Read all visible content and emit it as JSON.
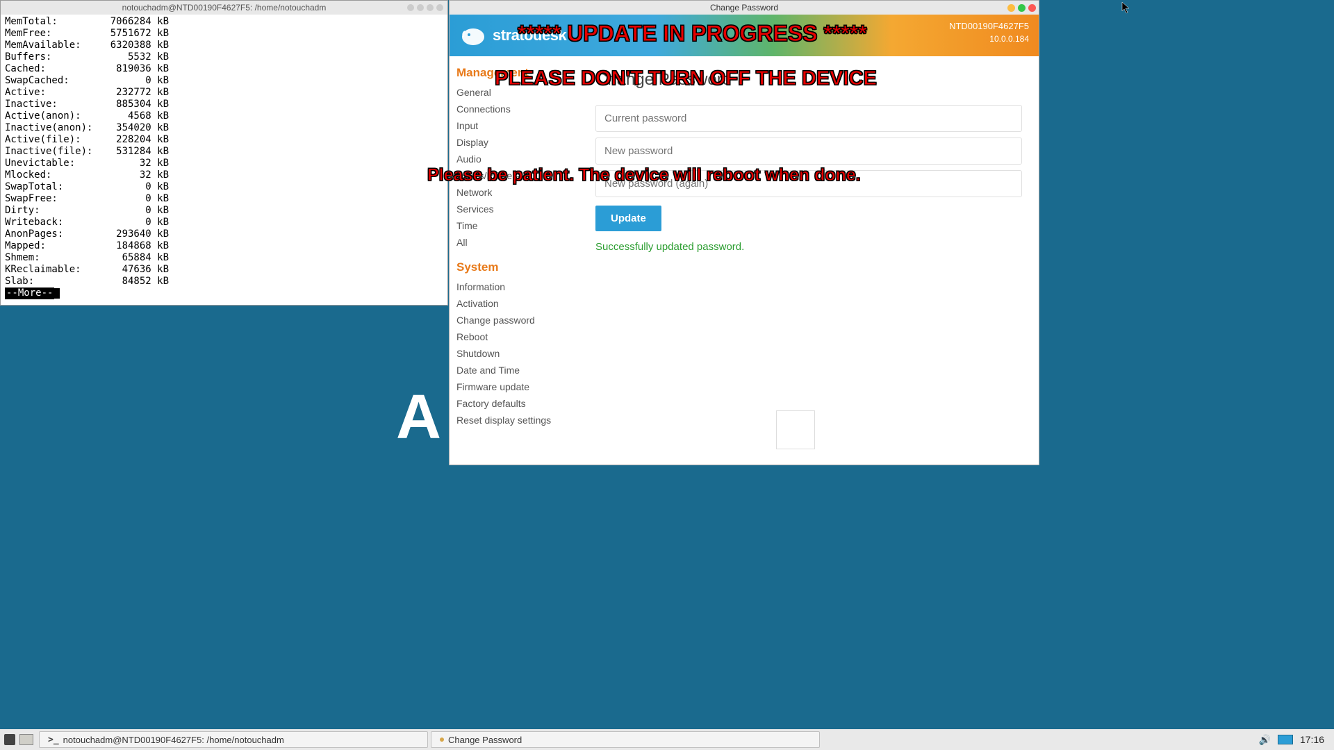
{
  "terminal": {
    "title": "notouchadm@NTD00190F4627F5: /home/notouchadm",
    "rows": [
      {
        "k": "MemTotal:",
        "v": "7066284 kB"
      },
      {
        "k": "MemFree:",
        "v": "5751672 kB"
      },
      {
        "k": "MemAvailable:",
        "v": "6320388 kB"
      },
      {
        "k": "Buffers:",
        "v": "5532 kB"
      },
      {
        "k": "Cached:",
        "v": "819036 kB"
      },
      {
        "k": "SwapCached:",
        "v": "0 kB"
      },
      {
        "k": "Active:",
        "v": "232772 kB"
      },
      {
        "k": "Inactive:",
        "v": "885304 kB"
      },
      {
        "k": "Active(anon):",
        "v": "4568 kB"
      },
      {
        "k": "Inactive(anon):",
        "v": "354020 kB"
      },
      {
        "k": "Active(file):",
        "v": "228204 kB"
      },
      {
        "k": "Inactive(file):",
        "v": "531284 kB"
      },
      {
        "k": "Unevictable:",
        "v": "32 kB"
      },
      {
        "k": "Mlocked:",
        "v": "32 kB"
      },
      {
        "k": "SwapTotal:",
        "v": "0 kB"
      },
      {
        "k": "SwapFree:",
        "v": "0 kB"
      },
      {
        "k": "Dirty:",
        "v": "0 kB"
      },
      {
        "k": "Writeback:",
        "v": "0 kB"
      },
      {
        "k": "AnonPages:",
        "v": "293640 kB"
      },
      {
        "k": "Mapped:",
        "v": "184868 kB"
      },
      {
        "k": "Shmem:",
        "v": "65884 kB"
      },
      {
        "k": "KReclaimable:",
        "v": "47636 kB"
      },
      {
        "k": "Slab:",
        "v": "84852 kB"
      }
    ],
    "more": "--More--"
  },
  "app": {
    "window_title": "Change Password",
    "brand": "stratodesk",
    "device_id": "NTD00190F4627F5",
    "device_ip": "10.0.0.184",
    "sidebar": {
      "section1": "Management",
      "items1": [
        "General",
        "Connections",
        "Input",
        "Display",
        "Audio",
        "Drives/Printers",
        "Network",
        "Services",
        "Time",
        "All"
      ],
      "section2": "System",
      "items2": [
        "Information",
        "Activation",
        "Change password",
        "Reboot",
        "Shutdown",
        "Date and Time",
        "Firmware update",
        "Factory defaults",
        "Reset display settings"
      ]
    },
    "main": {
      "page_title": "Change Password",
      "ph_current": "Current password",
      "ph_new": "New password",
      "ph_new2": "New password (again)",
      "button": "Update",
      "success": "Successfully updated password."
    }
  },
  "overlay": {
    "line1": "***** UPDATE IN PROGRESS *****",
    "line2": "PLEASE DON'T TURN OFF THE DEVICE",
    "line3": "Please be patient. The device will reboot when done."
  },
  "desktop": {
    "letter": "A"
  },
  "taskbar": {
    "btn1": "notouchadm@NTD00190F4627F5: /home/notouchadm",
    "btn2": "Change Password",
    "clock": "17:16"
  }
}
